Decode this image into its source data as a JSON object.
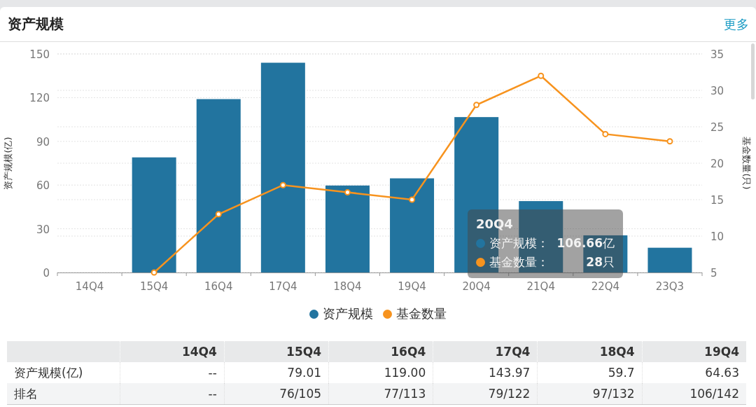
{
  "panel": {
    "title": "资产规模",
    "more_link": "更多"
  },
  "chart": {
    "chart_data": {
      "type": "bar",
      "grid": true,
      "categories": [
        "14Q4",
        "15Q4",
        "16Q4",
        "17Q4",
        "18Q4",
        "19Q4",
        "20Q4",
        "21Q4",
        "22Q4",
        "23Q3"
      ],
      "series": [
        {
          "name": "资产规模",
          "type": "bar",
          "color": "#22749f",
          "values": [
            0,
            79.01,
            119.0,
            143.97,
            59.7,
            64.63,
            106.66,
            49,
            25.5,
            17
          ]
        },
        {
          "name": "基金数量",
          "type": "line",
          "axis": "y2",
          "marker": true,
          "color": "#f7931e",
          "values": [
            null,
            5,
            13,
            17,
            16,
            15,
            28,
            32,
            24,
            23
          ]
        }
      ],
      "ylabel": "资产规模(亿)",
      "ylim": [
        0,
        150
      ],
      "yticks": [
        0,
        30,
        60,
        90,
        120,
        150
      ],
      "y2label": "基金数量(只)",
      "y2lim": [
        5,
        35
      ],
      "y2ticks": [
        5,
        10,
        15,
        20,
        25,
        30,
        35
      ]
    }
  },
  "tooltip": {
    "title": "20Q4",
    "items": [
      {
        "label": "资产规模：",
        "value": "106.66",
        "unit": "亿",
        "color": "#22749f"
      },
      {
        "label": "基金数量：",
        "value": "28",
        "unit": "只",
        "color": "#f7931e"
      }
    ]
  },
  "table": {
    "columns": [
      "14Q4",
      "15Q4",
      "16Q4",
      "17Q4",
      "18Q4",
      "19Q4"
    ],
    "rows": [
      {
        "label": "资产规模(亿)",
        "cells": [
          "--",
          "79.01",
          "119.00",
          "143.97",
          "59.7",
          "64.63"
        ]
      },
      {
        "label": "排名",
        "cells": [
          "--",
          "76/105",
          "77/113",
          "79/122",
          "97/132",
          "106/142"
        ]
      }
    ]
  }
}
